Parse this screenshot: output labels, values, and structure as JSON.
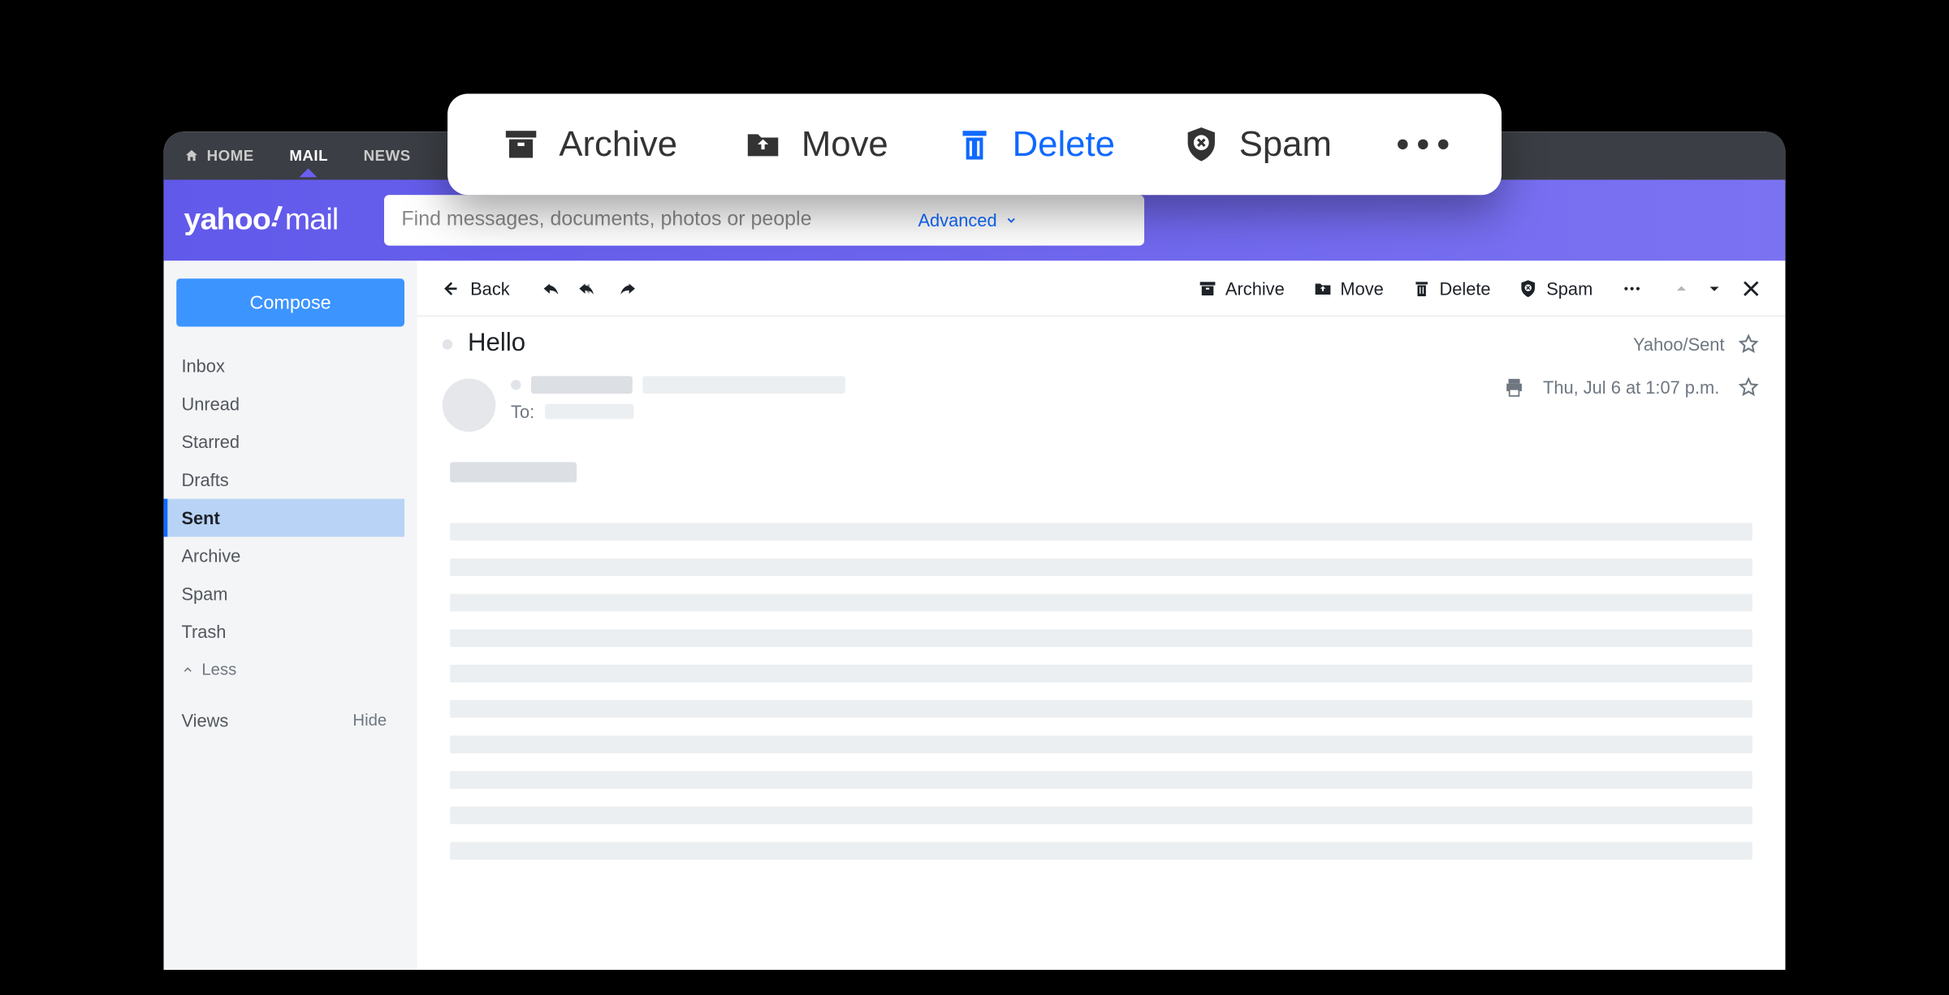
{
  "nav": {
    "home": "HOME",
    "mail": "MAIL",
    "news": "NEWS"
  },
  "logo": {
    "brand": "yahoo",
    "suffix": "mail"
  },
  "search": {
    "placeholder": "Find messages, documents, photos or people",
    "advanced": "Advanced"
  },
  "sidebar": {
    "compose": "Compose",
    "folders": [
      "Inbox",
      "Unread",
      "Starred",
      "Drafts",
      "Sent",
      "Archive",
      "Spam",
      "Trash"
    ],
    "activeIndex": 4,
    "less": "Less",
    "views": "Views",
    "hide": "Hide"
  },
  "toolbar": {
    "back": "Back",
    "archive": "Archive",
    "move": "Move",
    "delete": "Delete",
    "spam": "Spam"
  },
  "message": {
    "subject": "Hello",
    "folder": "Yahoo/Sent",
    "to_label": "To:",
    "date": "Thu, Jul 6 at 1:07 p.m."
  },
  "popover": {
    "archive": "Archive",
    "move": "Move",
    "delete": "Delete",
    "spam": "Spam"
  }
}
